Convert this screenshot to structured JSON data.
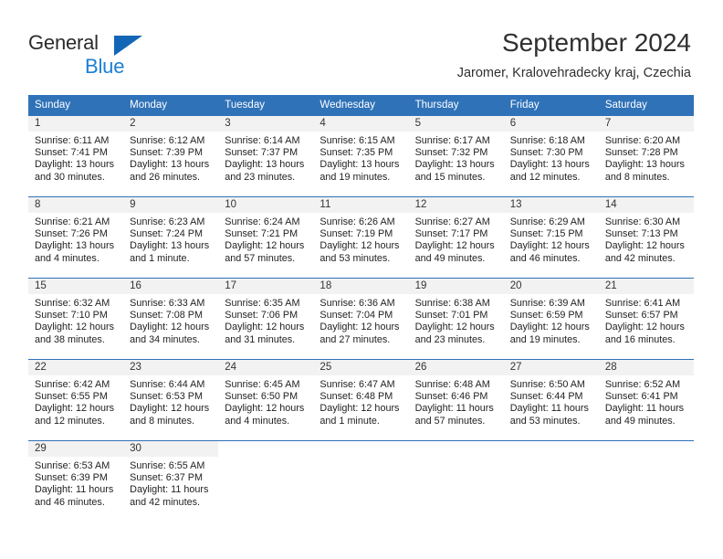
{
  "brand": {
    "line1": "General",
    "line2": "Blue",
    "triangle_color": "#1266b5",
    "blue_text_color": "#1b7fd4"
  },
  "header": {
    "title": "September 2024",
    "subtitle": "Jaromer, Kralovehradecky kraj, Czechia"
  },
  "theme": {
    "header_blue": "#2f72b8",
    "daynum_band": "#f2f2f2",
    "text": "#222222"
  },
  "weekday_headers": [
    "Sunday",
    "Monday",
    "Tuesday",
    "Wednesday",
    "Thursday",
    "Friday",
    "Saturday"
  ],
  "weeks": [
    [
      {
        "day": "1",
        "sunrise": "Sunrise: 6:11 AM",
        "sunset": "Sunset: 7:41 PM",
        "daylight1": "Daylight: 13 hours",
        "daylight2": "and 30 minutes."
      },
      {
        "day": "2",
        "sunrise": "Sunrise: 6:12 AM",
        "sunset": "Sunset: 7:39 PM",
        "daylight1": "Daylight: 13 hours",
        "daylight2": "and 26 minutes."
      },
      {
        "day": "3",
        "sunrise": "Sunrise: 6:14 AM",
        "sunset": "Sunset: 7:37 PM",
        "daylight1": "Daylight: 13 hours",
        "daylight2": "and 23 minutes."
      },
      {
        "day": "4",
        "sunrise": "Sunrise: 6:15 AM",
        "sunset": "Sunset: 7:35 PM",
        "daylight1": "Daylight: 13 hours",
        "daylight2": "and 19 minutes."
      },
      {
        "day": "5",
        "sunrise": "Sunrise: 6:17 AM",
        "sunset": "Sunset: 7:32 PM",
        "daylight1": "Daylight: 13 hours",
        "daylight2": "and 15 minutes."
      },
      {
        "day": "6",
        "sunrise": "Sunrise: 6:18 AM",
        "sunset": "Sunset: 7:30 PM",
        "daylight1": "Daylight: 13 hours",
        "daylight2": "and 12 minutes."
      },
      {
        "day": "7",
        "sunrise": "Sunrise: 6:20 AM",
        "sunset": "Sunset: 7:28 PM",
        "daylight1": "Daylight: 13 hours",
        "daylight2": "and 8 minutes."
      }
    ],
    [
      {
        "day": "8",
        "sunrise": "Sunrise: 6:21 AM",
        "sunset": "Sunset: 7:26 PM",
        "daylight1": "Daylight: 13 hours",
        "daylight2": "and 4 minutes."
      },
      {
        "day": "9",
        "sunrise": "Sunrise: 6:23 AM",
        "sunset": "Sunset: 7:24 PM",
        "daylight1": "Daylight: 13 hours",
        "daylight2": "and 1 minute."
      },
      {
        "day": "10",
        "sunrise": "Sunrise: 6:24 AM",
        "sunset": "Sunset: 7:21 PM",
        "daylight1": "Daylight: 12 hours",
        "daylight2": "and 57 minutes."
      },
      {
        "day": "11",
        "sunrise": "Sunrise: 6:26 AM",
        "sunset": "Sunset: 7:19 PM",
        "daylight1": "Daylight: 12 hours",
        "daylight2": "and 53 minutes."
      },
      {
        "day": "12",
        "sunrise": "Sunrise: 6:27 AM",
        "sunset": "Sunset: 7:17 PM",
        "daylight1": "Daylight: 12 hours",
        "daylight2": "and 49 minutes."
      },
      {
        "day": "13",
        "sunrise": "Sunrise: 6:29 AM",
        "sunset": "Sunset: 7:15 PM",
        "daylight1": "Daylight: 12 hours",
        "daylight2": "and 46 minutes."
      },
      {
        "day": "14",
        "sunrise": "Sunrise: 6:30 AM",
        "sunset": "Sunset: 7:13 PM",
        "daylight1": "Daylight: 12 hours",
        "daylight2": "and 42 minutes."
      }
    ],
    [
      {
        "day": "15",
        "sunrise": "Sunrise: 6:32 AM",
        "sunset": "Sunset: 7:10 PM",
        "daylight1": "Daylight: 12 hours",
        "daylight2": "and 38 minutes."
      },
      {
        "day": "16",
        "sunrise": "Sunrise: 6:33 AM",
        "sunset": "Sunset: 7:08 PM",
        "daylight1": "Daylight: 12 hours",
        "daylight2": "and 34 minutes."
      },
      {
        "day": "17",
        "sunrise": "Sunrise: 6:35 AM",
        "sunset": "Sunset: 7:06 PM",
        "daylight1": "Daylight: 12 hours",
        "daylight2": "and 31 minutes."
      },
      {
        "day": "18",
        "sunrise": "Sunrise: 6:36 AM",
        "sunset": "Sunset: 7:04 PM",
        "daylight1": "Daylight: 12 hours",
        "daylight2": "and 27 minutes."
      },
      {
        "day": "19",
        "sunrise": "Sunrise: 6:38 AM",
        "sunset": "Sunset: 7:01 PM",
        "daylight1": "Daylight: 12 hours",
        "daylight2": "and 23 minutes."
      },
      {
        "day": "20",
        "sunrise": "Sunrise: 6:39 AM",
        "sunset": "Sunset: 6:59 PM",
        "daylight1": "Daylight: 12 hours",
        "daylight2": "and 19 minutes."
      },
      {
        "day": "21",
        "sunrise": "Sunrise: 6:41 AM",
        "sunset": "Sunset: 6:57 PM",
        "daylight1": "Daylight: 12 hours",
        "daylight2": "and 16 minutes."
      }
    ],
    [
      {
        "day": "22",
        "sunrise": "Sunrise: 6:42 AM",
        "sunset": "Sunset: 6:55 PM",
        "daylight1": "Daylight: 12 hours",
        "daylight2": "and 12 minutes."
      },
      {
        "day": "23",
        "sunrise": "Sunrise: 6:44 AM",
        "sunset": "Sunset: 6:53 PM",
        "daylight1": "Daylight: 12 hours",
        "daylight2": "and 8 minutes."
      },
      {
        "day": "24",
        "sunrise": "Sunrise: 6:45 AM",
        "sunset": "Sunset: 6:50 PM",
        "daylight1": "Daylight: 12 hours",
        "daylight2": "and 4 minutes."
      },
      {
        "day": "25",
        "sunrise": "Sunrise: 6:47 AM",
        "sunset": "Sunset: 6:48 PM",
        "daylight1": "Daylight: 12 hours",
        "daylight2": "and 1 minute."
      },
      {
        "day": "26",
        "sunrise": "Sunrise: 6:48 AM",
        "sunset": "Sunset: 6:46 PM",
        "daylight1": "Daylight: 11 hours",
        "daylight2": "and 57 minutes."
      },
      {
        "day": "27",
        "sunrise": "Sunrise: 6:50 AM",
        "sunset": "Sunset: 6:44 PM",
        "daylight1": "Daylight: 11 hours",
        "daylight2": "and 53 minutes."
      },
      {
        "day": "28",
        "sunrise": "Sunrise: 6:52 AM",
        "sunset": "Sunset: 6:41 PM",
        "daylight1": "Daylight: 11 hours",
        "daylight2": "and 49 minutes."
      }
    ],
    [
      {
        "day": "29",
        "sunrise": "Sunrise: 6:53 AM",
        "sunset": "Sunset: 6:39 PM",
        "daylight1": "Daylight: 11 hours",
        "daylight2": "and 46 minutes."
      },
      {
        "day": "30",
        "sunrise": "Sunrise: 6:55 AM",
        "sunset": "Sunset: 6:37 PM",
        "daylight1": "Daylight: 11 hours",
        "daylight2": "and 42 minutes."
      },
      {
        "day": "",
        "sunrise": "",
        "sunset": "",
        "daylight1": "",
        "daylight2": ""
      },
      {
        "day": "",
        "sunrise": "",
        "sunset": "",
        "daylight1": "",
        "daylight2": ""
      },
      {
        "day": "",
        "sunrise": "",
        "sunset": "",
        "daylight1": "",
        "daylight2": ""
      },
      {
        "day": "",
        "sunrise": "",
        "sunset": "",
        "daylight1": "",
        "daylight2": ""
      },
      {
        "day": "",
        "sunrise": "",
        "sunset": "",
        "daylight1": "",
        "daylight2": ""
      }
    ]
  ]
}
